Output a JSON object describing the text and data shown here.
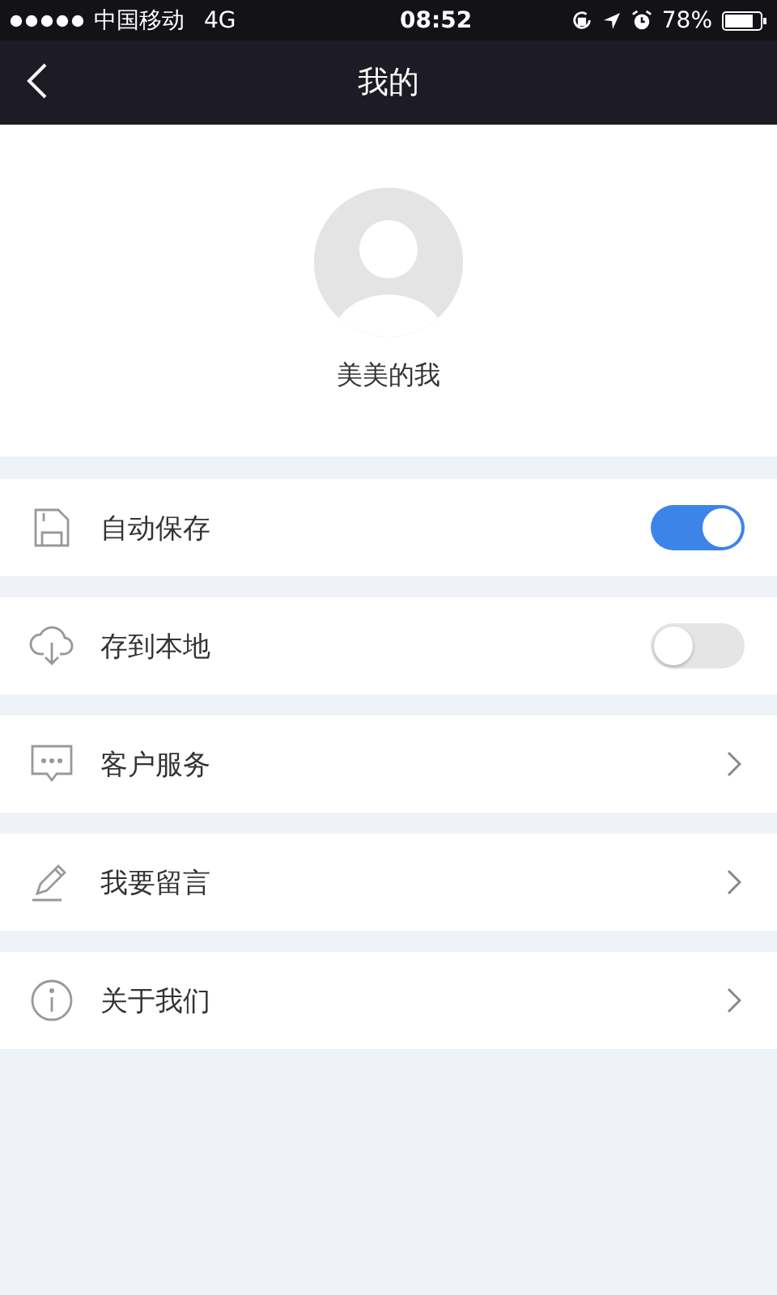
{
  "status_bar": {
    "carrier": "中国移动",
    "network": "4G",
    "time": "08:52",
    "battery": "78%"
  },
  "nav_bar": {
    "title": "我的"
  },
  "profile": {
    "name": "美美的我"
  },
  "settings": [
    {
      "kind": "toggle",
      "label": "自动保存",
      "on": true
    },
    {
      "kind": "toggle",
      "label": "存到本地",
      "on": false
    },
    {
      "kind": "link",
      "label": "客户服务"
    },
    {
      "kind": "link",
      "label": "我要留言"
    },
    {
      "kind": "link",
      "label": "关于我们"
    }
  ]
}
